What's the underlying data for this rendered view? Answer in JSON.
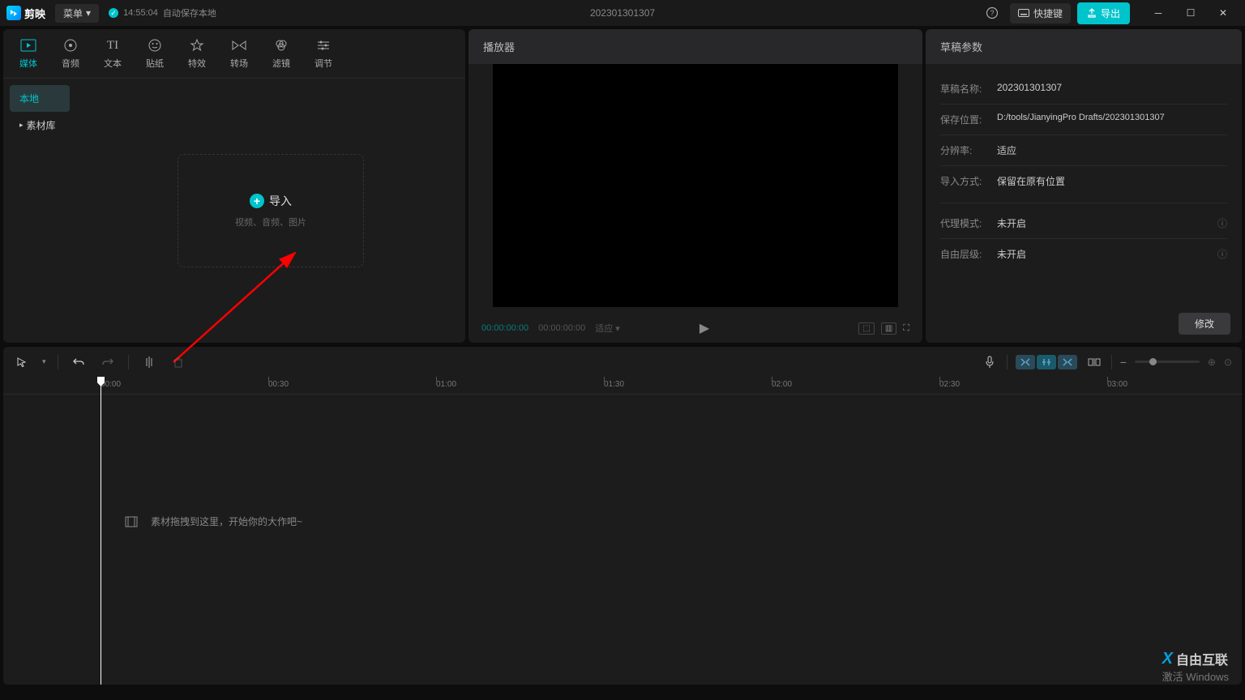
{
  "app": {
    "name": "剪映"
  },
  "titlebar": {
    "menu": "菜单",
    "autosave_time": "14:55:04",
    "autosave_text": "自动保存本地",
    "project": "202301301307",
    "shortcuts": "快捷键",
    "export": "导出"
  },
  "tabs": [
    {
      "label": "媒体",
      "icon": "media"
    },
    {
      "label": "音频",
      "icon": "audio"
    },
    {
      "label": "文本",
      "icon": "text"
    },
    {
      "label": "贴纸",
      "icon": "sticker"
    },
    {
      "label": "特效",
      "icon": "effect"
    },
    {
      "label": "转场",
      "icon": "transition"
    },
    {
      "label": "滤镜",
      "icon": "filter"
    },
    {
      "label": "调节",
      "icon": "adjust"
    }
  ],
  "sidebar": {
    "items": [
      "本地",
      "素材库"
    ]
  },
  "import": {
    "label": "导入",
    "sub": "视频、音频、图片"
  },
  "player": {
    "title": "播放器",
    "time_current": "00:00:00:00",
    "time_total": "00:00:00:00",
    "speed_label": "适应"
  },
  "draft": {
    "title": "草稿参数",
    "rows": [
      {
        "label": "草稿名称:",
        "value": "202301301307"
      },
      {
        "label": "保存位置:",
        "value": "D:/tools/JianyingPro Drafts/202301301307"
      },
      {
        "label": "分辨率:",
        "value": "适应"
      },
      {
        "label": "导入方式:",
        "value": "保留在原有位置"
      },
      {
        "label": "代理模式:",
        "value": "未开启"
      },
      {
        "label": "自由层级:",
        "value": "未开启"
      }
    ],
    "modify": "修改"
  },
  "timeline": {
    "ticks": [
      "00:00",
      "00:30",
      "01:00",
      "01:30",
      "02:00",
      "02:30",
      "03:00"
    ],
    "empty_hint": "素材拖拽到这里，开始你的大作吧~"
  },
  "watermark": {
    "brand": "自由互联",
    "sub": "激活 Windows"
  }
}
